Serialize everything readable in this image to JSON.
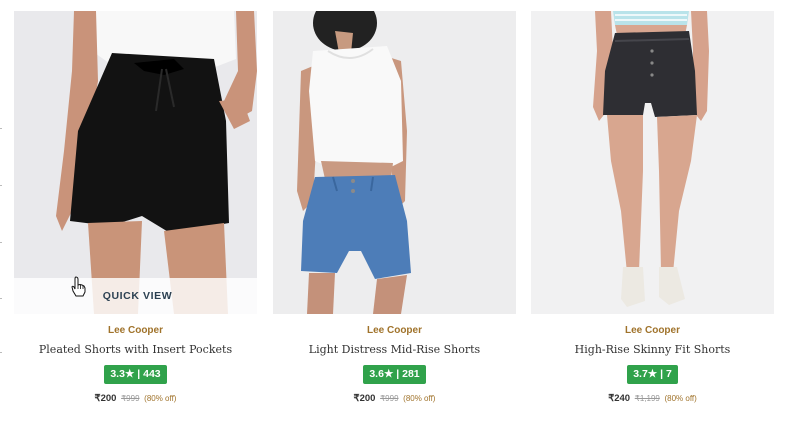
{
  "products": [
    {
      "brand": "Lee Cooper",
      "name": "Pleated Shorts with Insert Pockets",
      "rating": "3.3★ | 443",
      "price": "₹200",
      "mrp": "₹999",
      "discount": "(80% off)",
      "quick_view": "QUICK VIEW"
    },
    {
      "brand": "Lee Cooper",
      "name": "Light Distress Mid-Rise Shorts",
      "rating": "3.6★ | 281",
      "price": "₹200",
      "mrp": "₹999",
      "discount": "(80% off)"
    },
    {
      "brand": "Lee Cooper",
      "name": "High-Rise Skinny Fit Shorts",
      "rating": "3.7★ | 7",
      "price": "₹240",
      "mrp": "₹1,199",
      "discount": "(80% off)"
    }
  ],
  "colors": {
    "brand_text": "#a0732b",
    "rating_badge": "#30a24b",
    "photo_bg": "#eeeef0"
  }
}
